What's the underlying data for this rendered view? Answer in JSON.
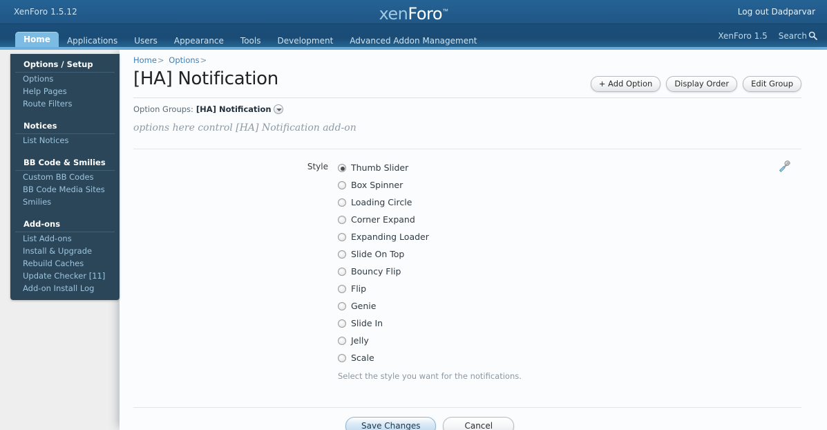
{
  "header": {
    "version": "XenForo 1.5.12",
    "logo_a": "xen",
    "logo_b": "Foro",
    "logo_tm": "™",
    "logout": "Log out Dadparvar"
  },
  "nav": {
    "tabs": [
      {
        "label": "Home",
        "selected": true
      },
      {
        "label": "Applications",
        "selected": false
      },
      {
        "label": "Users",
        "selected": false
      },
      {
        "label": "Appearance",
        "selected": false
      },
      {
        "label": "Tools",
        "selected": false
      },
      {
        "label": "Development",
        "selected": false
      },
      {
        "label": "Advanced Addon Management",
        "selected": false
      }
    ],
    "right": [
      {
        "label": "XenForo 1.5",
        "icon": ""
      },
      {
        "label": "Search",
        "icon": "search-icon"
      }
    ]
  },
  "sidebar": {
    "groups": [
      {
        "title": "Options / Setup",
        "links": [
          "Options",
          "Help Pages",
          "Route Filters"
        ]
      },
      {
        "title": "Notices",
        "links": [
          "List Notices"
        ]
      },
      {
        "title": "BB Code & Smilies",
        "links": [
          "Custom BB Codes",
          "BB Code Media Sites",
          "Smilies"
        ]
      },
      {
        "title": "Add-ons",
        "links": [
          "List Add-ons",
          "Install & Upgrade",
          "Rebuild Caches",
          "Update Checker [11]",
          "Add-on Install Log"
        ]
      }
    ]
  },
  "main": {
    "breadcrumb": [
      {
        "label": "Home",
        "sep": ">"
      },
      {
        "label": "Options",
        "sep": ">"
      }
    ],
    "title": "[HA] Notification",
    "title_buttons": [
      {
        "label": "+ Add Option",
        "name": "add-option-button"
      },
      {
        "label": "Display Order",
        "name": "display-order-button"
      },
      {
        "label": "Edit Group",
        "name": "edit-group-button"
      }
    ],
    "option_groups_label": "Option Groups:",
    "option_groups_value": "[HA] Notification",
    "group_description": "options here control [HA] Notification add-on",
    "option": {
      "label": "Style",
      "hint": "Select the style you want for the notifications.",
      "tool_icon": "screwdriver-icon",
      "choices": [
        {
          "label": "Thumb Slider",
          "checked": true
        },
        {
          "label": "Box Spinner",
          "checked": false
        },
        {
          "label": "Loading Circle",
          "checked": false
        },
        {
          "label": "Corner Expand",
          "checked": false
        },
        {
          "label": "Expanding Loader",
          "checked": false
        },
        {
          "label": "Slide On Top",
          "checked": false
        },
        {
          "label": "Bouncy Flip",
          "checked": false
        },
        {
          "label": "Flip",
          "checked": false
        },
        {
          "label": "Genie",
          "checked": false
        },
        {
          "label": "Slide In",
          "checked": false
        },
        {
          "label": "Jelly",
          "checked": false
        },
        {
          "label": "Scale",
          "checked": false
        }
      ]
    },
    "footer": {
      "save_label": "Save Changes",
      "cancel_label": "Cancel"
    }
  },
  "colors": {
    "header_blue": "#1f5786",
    "nav_blue": "#1b4e79",
    "tab_active": "#7cbbe3",
    "sidebar_bg": "#2b4659",
    "sidebar_link": "#9dc4de",
    "accent_strip": "#6fb1dd",
    "page_bg": "#eeeeee",
    "panel_bg": "#fbfcfd"
  }
}
